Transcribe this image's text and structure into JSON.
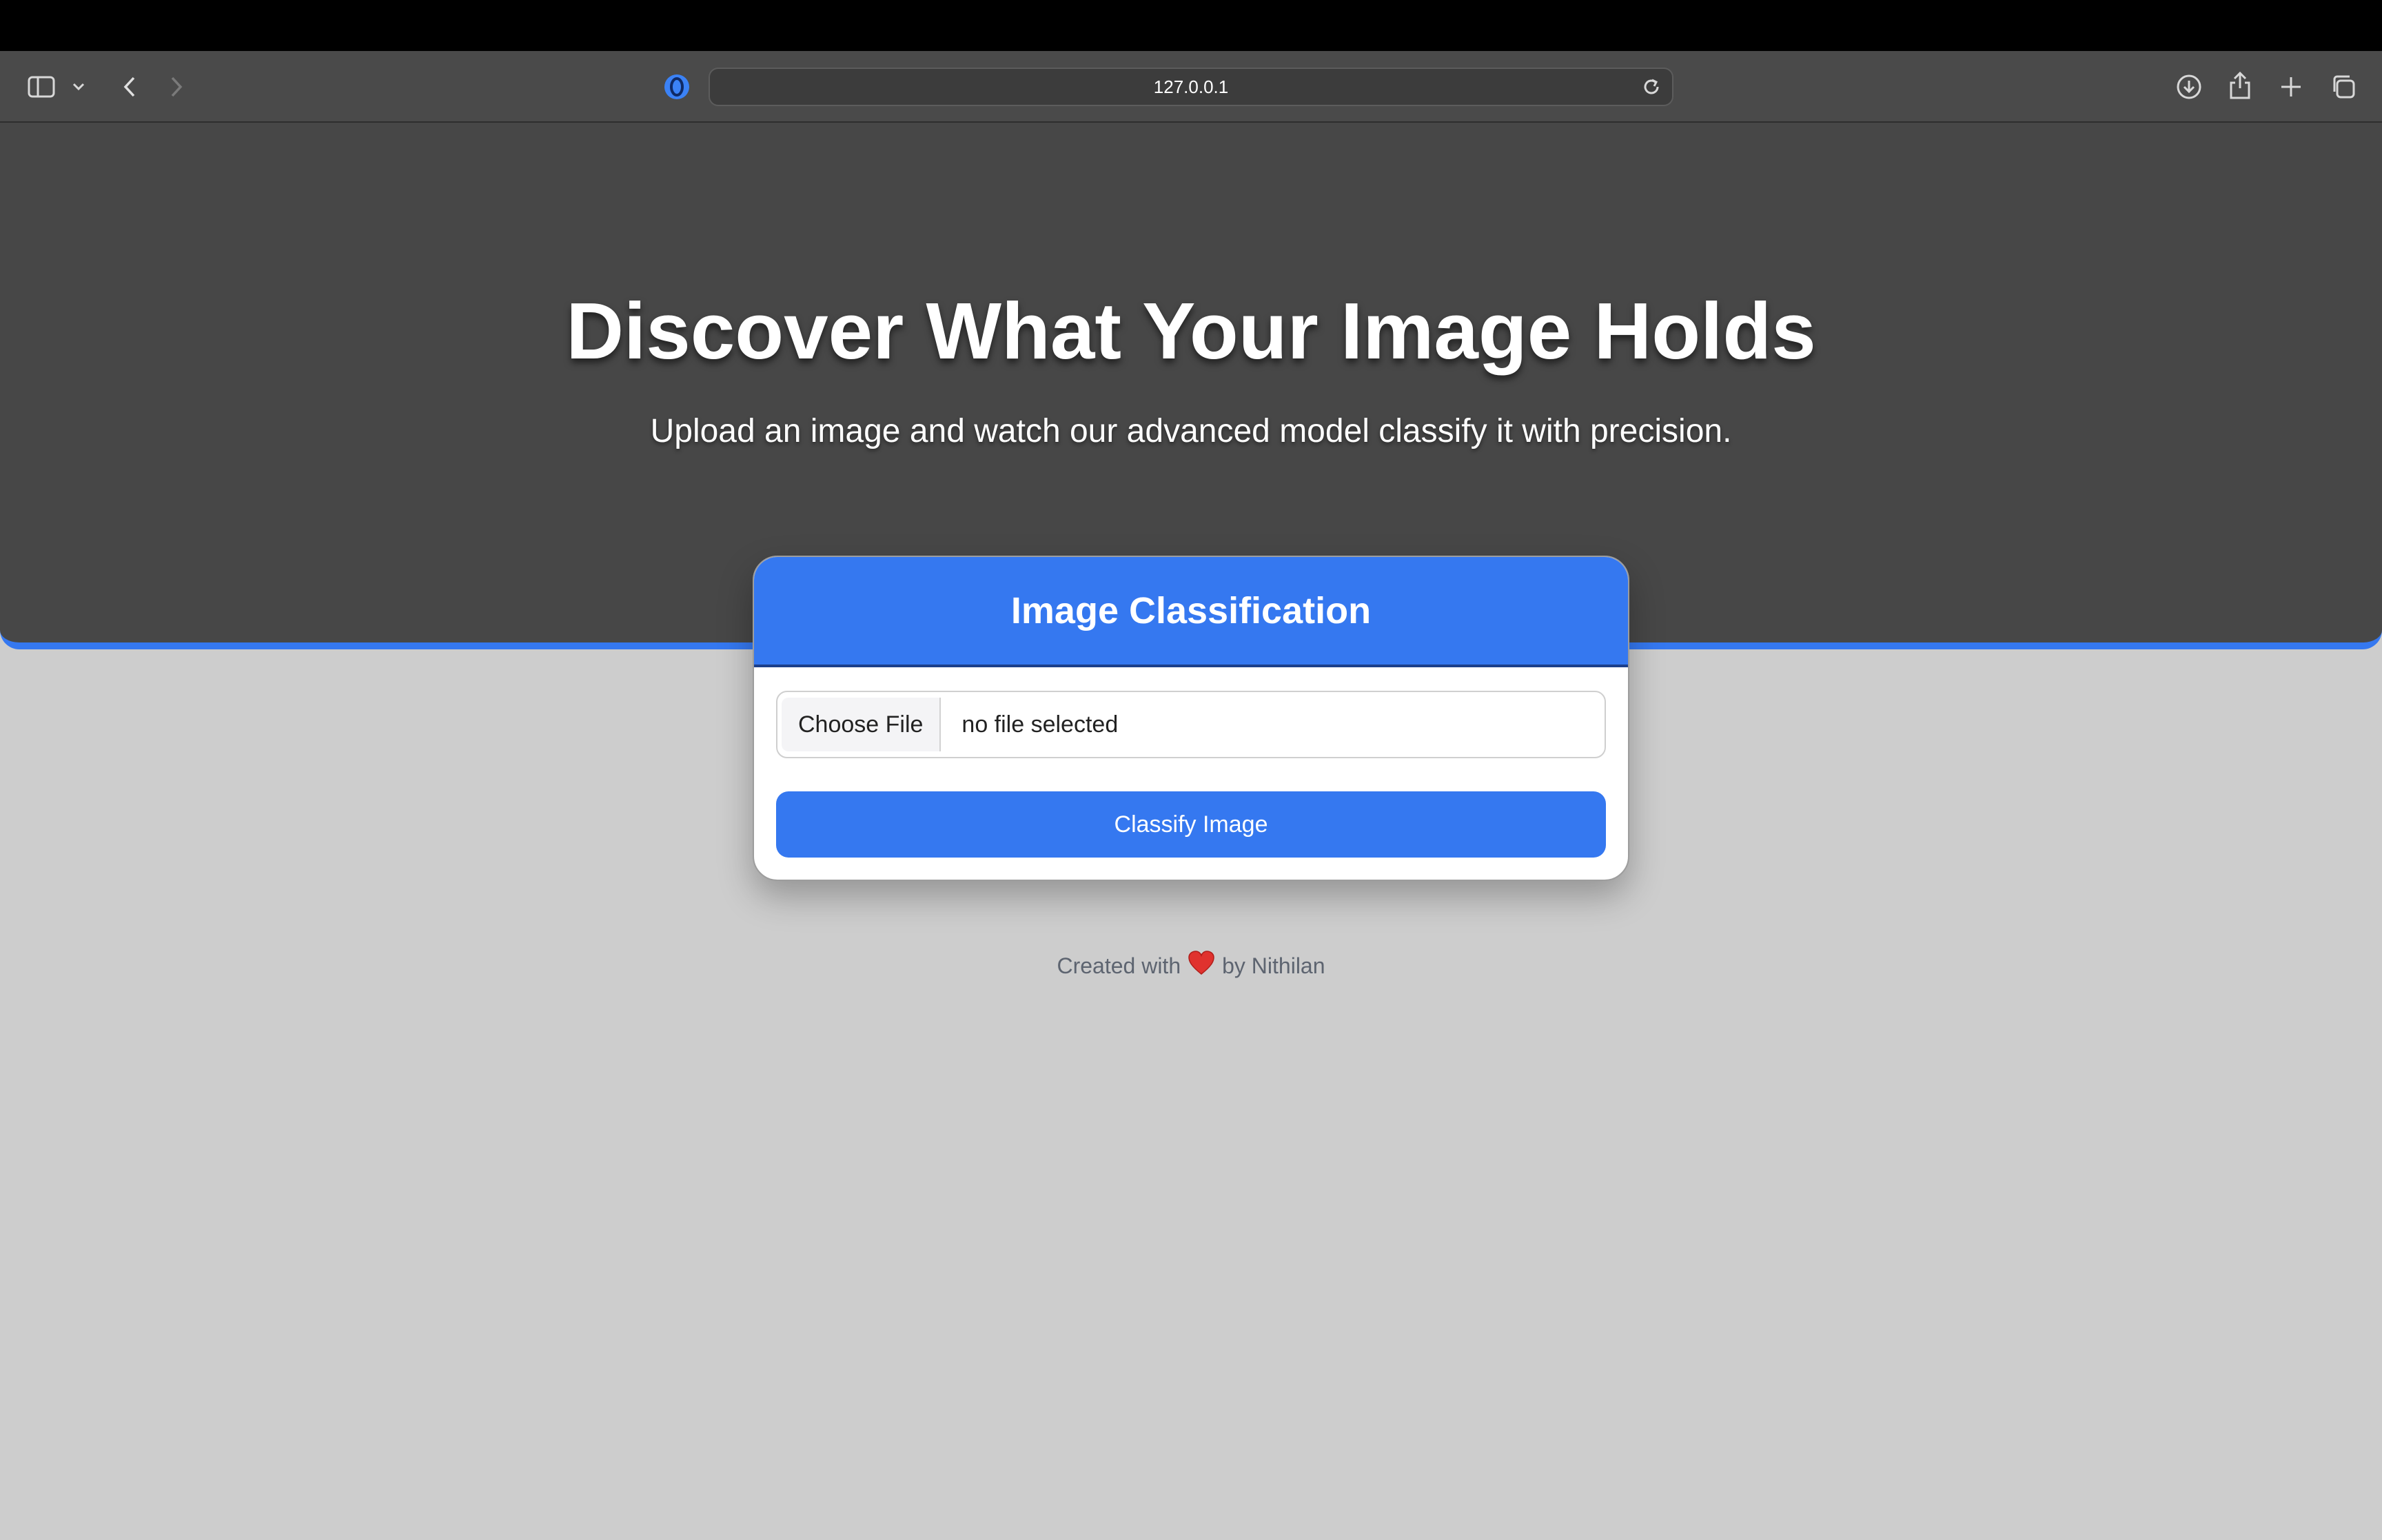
{
  "browser": {
    "url": "127.0.0.1",
    "icons": {
      "sidebar": "sidebar-icon",
      "sidebar_menu": "chevron-down-icon",
      "back": "chevron-left-icon",
      "forward": "chevron-right-icon",
      "site": "privacy-shield-icon",
      "reload": "reload-icon",
      "download": "download-icon",
      "share": "share-icon",
      "new_tab": "plus-icon",
      "tabs": "tab-overview-icon"
    }
  },
  "hero": {
    "title": "Discover What Your Image Holds",
    "subtitle": "Upload an image and watch our advanced model classify it with precision."
  },
  "card": {
    "title": "Image Classification",
    "file_button_label": "Choose File",
    "file_status": "no file selected",
    "submit_label": "Classify Image"
  },
  "footer": {
    "prefix": "Created with",
    "icon": "heart-icon",
    "suffix": "by Nithilan"
  },
  "colors": {
    "accent": "#3578f0",
    "hero_bg": "#474747",
    "page_bg": "#cdcdcd"
  }
}
